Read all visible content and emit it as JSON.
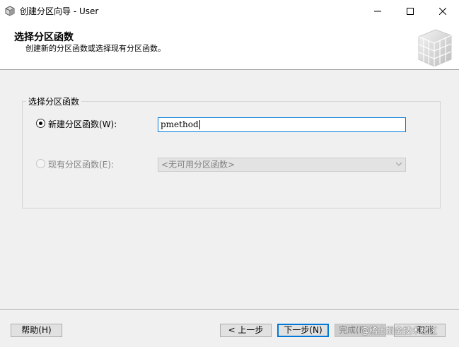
{
  "window": {
    "title": "创建分区向导 - User",
    "controls": [
      "minimize-icon",
      "maximize-icon",
      "close-icon"
    ]
  },
  "header": {
    "title": "选择分区函数",
    "subtitle": "创建新的分区函数或选择现有分区函数。"
  },
  "group": {
    "legend": "选择分区函数",
    "option_new": {
      "label": "新建分区函数(W):",
      "selected": true,
      "value": "pmethod"
    },
    "option_existing": {
      "label": "现有分区函数(E):",
      "selected": false,
      "enabled": false,
      "select_value": "<无可用分区函数>"
    }
  },
  "footer": {
    "help_label": "帮助(H)",
    "back_label": "< 上一步",
    "next_label": "下一步(N)",
    "finish_label": "完成(F",
    "cancel_label": "取消",
    "watermark": "@稀土掘金技术社区"
  },
  "colors": {
    "accent": "#0078d7",
    "background": "#f0f0f0",
    "disabled_text": "#838383"
  }
}
